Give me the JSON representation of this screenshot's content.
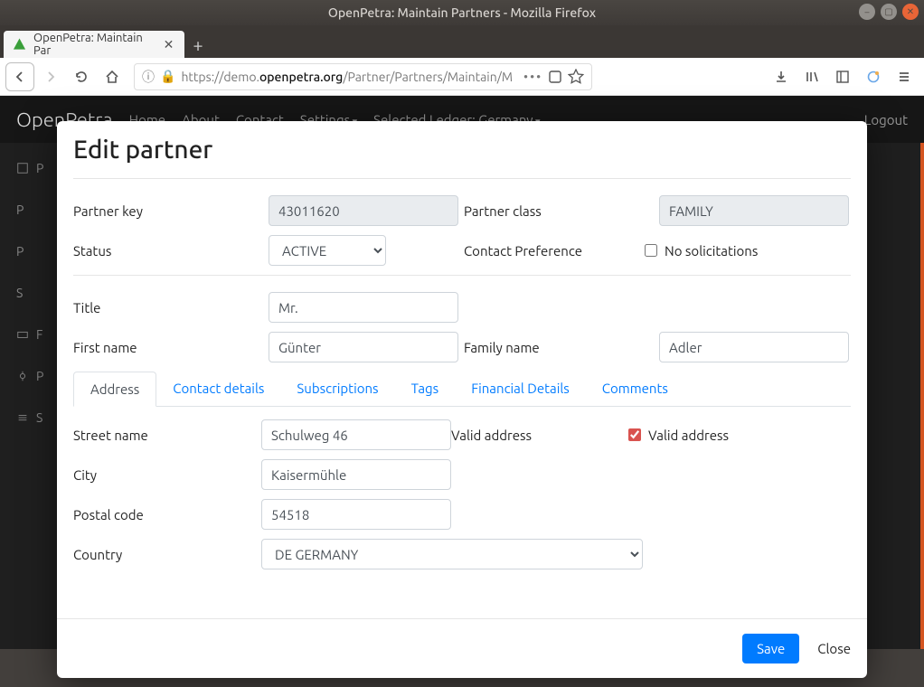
{
  "window": {
    "title": "OpenPetra: Maintain Partners - Mozilla Firefox"
  },
  "browser": {
    "tab_title": "OpenPetra: Maintain Par",
    "url_prefix": "https://demo.",
    "url_domain": "openpetra.org",
    "url_suffix": "/Partner/Partners/Maintain/M"
  },
  "nav": {
    "brand": "OpenPetra",
    "items": [
      "Home",
      "About",
      "Contact",
      "Settings",
      "Selected Ledger: Germany"
    ],
    "logout": "Logout"
  },
  "modal": {
    "title": "Edit partner",
    "labels": {
      "partner_key": "Partner key",
      "partner_class": "Partner class",
      "status": "Status",
      "contact_pref": "Contact Preference",
      "no_solicitations": "No solicitations",
      "title_field": "Title",
      "first_name": "First name",
      "family_name": "Family name",
      "street_name": "Street name",
      "valid_address": "Valid address",
      "valid_address_chk": "Valid address",
      "city": "City",
      "postal_code": "Postal code",
      "country": "Country"
    },
    "values": {
      "partner_key": "43011620",
      "partner_class": "FAMILY",
      "status": "ACTIVE",
      "title": "Mr.",
      "first_name": "Günter",
      "family_name": "Adler",
      "street_name": "Schulweg 46",
      "city": "Kaisermühle",
      "postal_code": "54518",
      "country": "DE GERMANY"
    },
    "tabs": [
      "Address",
      "Contact details",
      "Subscriptions",
      "Tags",
      "Financial Details",
      "Comments"
    ],
    "buttons": {
      "save": "Save",
      "close": "Close"
    }
  }
}
